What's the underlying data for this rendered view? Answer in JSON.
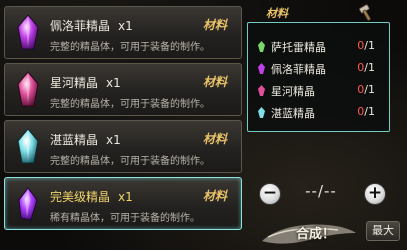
{
  "items": [
    {
      "name": "佩洛菲精晶",
      "qty": "x1",
      "type": "材料",
      "desc": "完整的精晶体，可用于装备的制作。",
      "gem_color": "#c040e8",
      "name_color": "#ece8de",
      "selected": false
    },
    {
      "name": "星河精晶",
      "qty": "x1",
      "type": "材料",
      "desc": "完整的精晶体，可用于装备的制作。",
      "gem_color": "#e0509a",
      "name_color": "#ece8de",
      "selected": false
    },
    {
      "name": "湛蓝精晶",
      "qty": "x1",
      "type": "材料",
      "desc": "完整的精晶体，可用于装备的制作。",
      "gem_color": "#7fe0e8",
      "name_color": "#ece8de",
      "selected": false
    },
    {
      "name": "完美级精晶",
      "qty": "x1",
      "type": "材料",
      "desc": "稀有精晶体，可用于装备的制作。",
      "gem_color": "#b040ff",
      "name_color": "#f0d46a",
      "selected": true
    }
  ],
  "materials": {
    "header": "材料",
    "tool_icon": "hammer-icon",
    "rows": [
      {
        "name": "萨托雷精晶",
        "have": "0",
        "need": "/1",
        "dot_color": "#7ad86a"
      },
      {
        "name": "佩洛菲精晶",
        "have": "0",
        "need": "/1",
        "dot_color": "#c040e8"
      },
      {
        "name": "星河精晶",
        "have": "0",
        "need": "/1",
        "dot_color": "#e0509a"
      },
      {
        "name": "湛蓝精晶",
        "have": "0",
        "need": "/1",
        "dot_color": "#7fe0e8"
      }
    ]
  },
  "quantity": {
    "minus": "−",
    "value": "--/--",
    "plus": "+"
  },
  "craft_label": "合成！",
  "max_label": "最大"
}
